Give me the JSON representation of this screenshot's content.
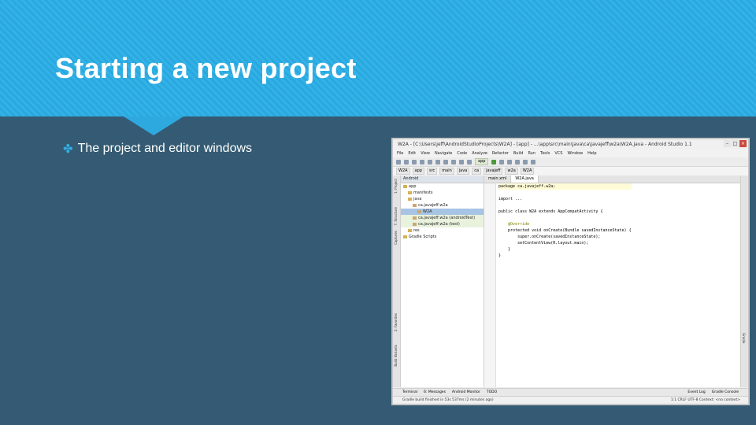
{
  "slide": {
    "title": "Starting a new project",
    "bullet": "The project and editor windows"
  },
  "ide": {
    "window_title": "W2A - [C:\\Users\\jeff\\AndroidStudioProjects\\W2A] - [app] - ...\\app\\src\\main\\java\\ca\\javajeff\\w2a\\W2A.java - Android Studio 1.1",
    "menu": [
      "File",
      "Edit",
      "View",
      "Navigate",
      "Code",
      "Analyze",
      "Refactor",
      "Build",
      "Run",
      "Tools",
      "VCS",
      "Window",
      "Help"
    ],
    "run_config": "app",
    "breadcrumbs": [
      "W2A",
      "app",
      "src",
      "main",
      "java",
      "ca",
      "javajeff",
      "w2a",
      "W2A"
    ],
    "project_header": "Android",
    "tree": [
      {
        "label": "app",
        "indent": 0
      },
      {
        "label": "manifests",
        "indent": 1
      },
      {
        "label": "java",
        "indent": 1
      },
      {
        "label": "ca.javajeff.w2a",
        "indent": 2
      },
      {
        "label": "W2A",
        "indent": 3
      },
      {
        "label": "ca.javajeff.w2a (androidTest)",
        "indent": 2
      },
      {
        "label": "ca.javajeff.w2a (test)",
        "indent": 2
      },
      {
        "label": "res",
        "indent": 1
      },
      {
        "label": "Gradle Scripts",
        "indent": 0
      }
    ],
    "editor_tabs": [
      "main.xml",
      "W2A.java"
    ],
    "code": [
      "package ca.javajeff.w2a;",
      "",
      "import ...",
      "",
      "public class W2A extends AppCompatActivity {",
      "",
      "    @Override",
      "    protected void onCreate(Bundle savedInstanceState) {",
      "        super.onCreate(savedInstanceState);",
      "        setContentView(R.layout.main);",
      "    }",
      "}"
    ],
    "bottom_tools_left": [
      "Terminal",
      "6: Messages",
      "Android Monitor",
      "TODO"
    ],
    "bottom_tools_right": [
      "Event Log",
      "Gradle Console"
    ],
    "status_text": "Gradle build finished in 53s 537ms (2 minutes ago)",
    "status_right": "1:1  CRLF  UTF-8  Context: <no context>",
    "left_strip_labels": [
      "1: Project",
      "7: Structure",
      "Captures",
      "2: Favorites",
      "Build Variants"
    ],
    "right_strip_labels": [
      "Gradle"
    ]
  }
}
